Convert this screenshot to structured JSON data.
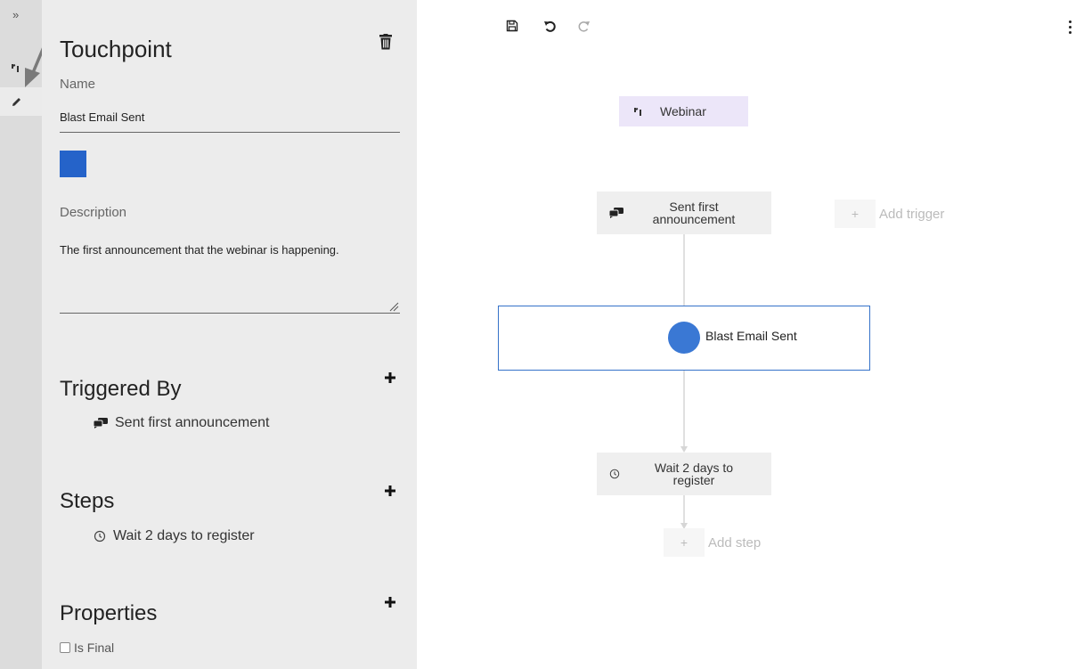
{
  "rail": {
    "expand_glyph": "»",
    "items": [
      {
        "icon": "touchpoint-icon"
      },
      {
        "icon": "pencil-icon"
      }
    ]
  },
  "panel": {
    "title": "Touchpoint",
    "name_label": "Name",
    "name_value": "Blast Email Sent",
    "color": "#2563c9",
    "description_label": "Description",
    "description_value": "The first announcement that the webinar is happening.",
    "triggered_by": {
      "title": "Triggered By",
      "items": [
        {
          "icon": "chat-icon",
          "label": "Sent first announcement"
        }
      ]
    },
    "steps": {
      "title": "Steps",
      "items": [
        {
          "icon": "clock-icon",
          "label": "Wait 2 days to register"
        }
      ]
    },
    "properties": {
      "title": "Properties",
      "is_final_label": "Is Final",
      "is_final_checked": false
    }
  },
  "toolbar": {
    "items": [
      "save-icon",
      "undo-icon",
      "redo-icon"
    ],
    "menu": "more-vertical-icon"
  },
  "canvas": {
    "webinar_label": "Webinar",
    "trigger_line1": "Sent first",
    "trigger_line2": "announcement",
    "add_trigger_label": "Add trigger",
    "touchpoint_label": "Blast Email Sent",
    "touchpoint_color": "#3a78d4",
    "step_line1": "Wait 2 days to",
    "step_line2": "register",
    "add_step_label": "Add step",
    "plus_glyph": "+"
  }
}
